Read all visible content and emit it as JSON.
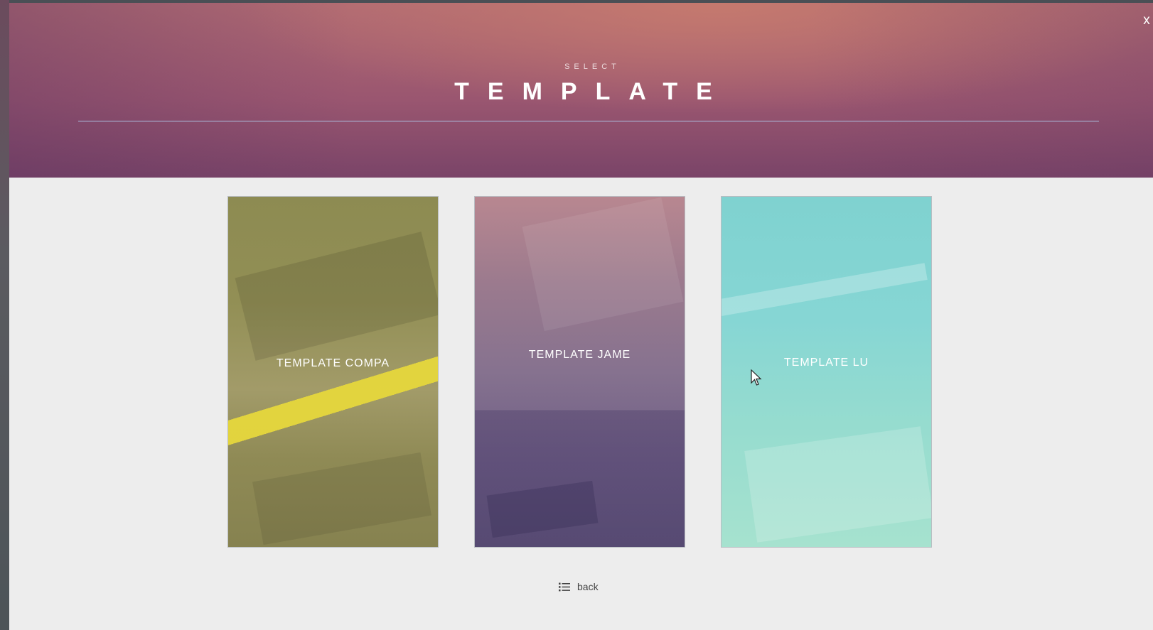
{
  "header": {
    "subtitle": "SELECT",
    "title": "TEMPLATE",
    "close_label": "x"
  },
  "templates": [
    {
      "label": "TEMPLATE COMPA",
      "tint": "#8d8b52"
    },
    {
      "label": "TEMPLATE JAME",
      "tint": "#86728f"
    },
    {
      "label": "TEMPLATE LU",
      "tint": "#86d6d4"
    }
  ],
  "footer": {
    "back_label": "back",
    "back_icon": "list-icon"
  },
  "colors": {
    "header_top": "#b06a73",
    "header_bottom": "#7a4468",
    "accent_line": "#afcdf0",
    "background": "#ededed"
  }
}
